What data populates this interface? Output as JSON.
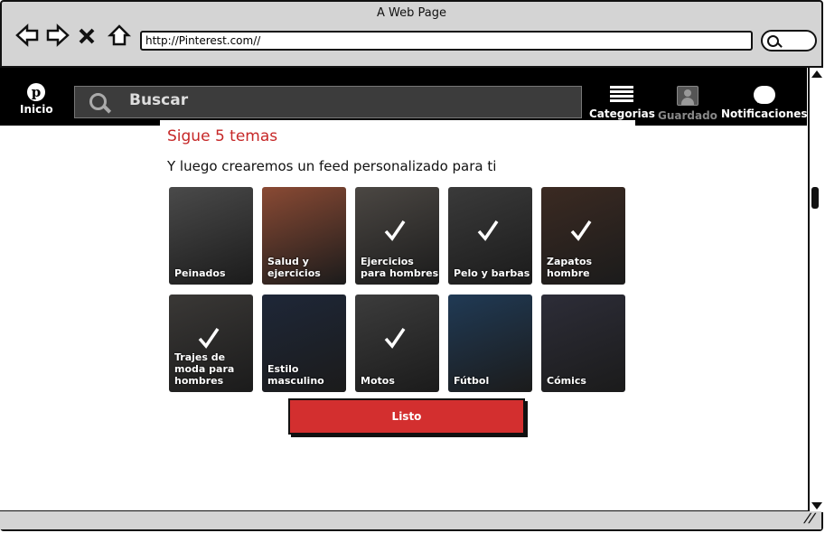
{
  "window": {
    "title": "A Web Page",
    "url": "http://Pinterest.com//"
  },
  "topnav": {
    "home_label": "Inicio",
    "search_placeholder": "Buscar",
    "categories_label": "Categorias",
    "saved_label": "Guardado",
    "notifications_label": "Notificaciones"
  },
  "panel": {
    "title": "Sigue 5 temas",
    "subtitle": "Y luego crearemos un feed personalizado para ti",
    "done_label": "Listo"
  },
  "topics": [
    {
      "label": "Peinados",
      "selected": false,
      "color": "#4a4a4a"
    },
    {
      "label": "Salud y ejercicios",
      "selected": false,
      "color": "#8a4a34"
    },
    {
      "label": "Ejercicios para hombres",
      "selected": true,
      "color": "#4b4743"
    },
    {
      "label": "Pelo y barbas",
      "selected": true,
      "color": "#3a3a3a"
    },
    {
      "label": "Zapatos hombre",
      "selected": true,
      "color": "#3b2a22"
    },
    {
      "label": "Trajes de moda para hombres",
      "selected": true,
      "color": "#3a3836"
    },
    {
      "label": "Estilo masculino",
      "selected": false,
      "color": "#1e2738"
    },
    {
      "label": "Motos",
      "selected": true,
      "color": "#3c3c3c"
    },
    {
      "label": "Fútbol",
      "selected": false,
      "color": "#203a55"
    },
    {
      "label": "Cómics",
      "selected": false,
      "color": "#2d2d38"
    }
  ]
}
